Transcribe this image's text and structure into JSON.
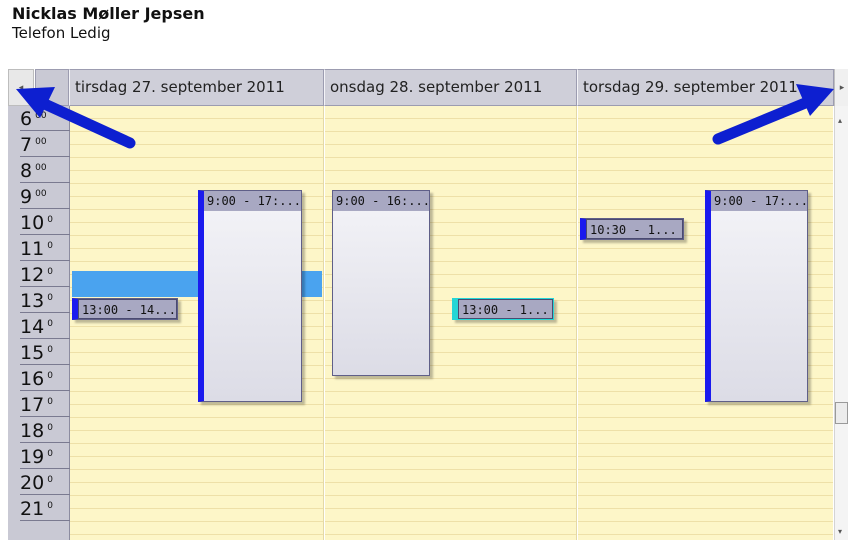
{
  "owner": {
    "name": "Nicklas Møller Jepsen",
    "subtitle": "Telefon Ledig"
  },
  "nav": {
    "prev_glyph": "◂",
    "next_glyph": "▸"
  },
  "days": [
    {
      "label": "tirsdag 27. september 2011"
    },
    {
      "label": "onsdag 28. september 2011"
    },
    {
      "label": "torsdag 29. september 2011"
    }
  ],
  "hours": [
    {
      "h": "6",
      "m": "00"
    },
    {
      "h": "7",
      "m": "00"
    },
    {
      "h": "8",
      "m": "00"
    },
    {
      "h": "9",
      "m": "00"
    },
    {
      "h": "10",
      "m": "0"
    },
    {
      "h": "11",
      "m": "0"
    },
    {
      "h": "12",
      "m": "0"
    },
    {
      "h": "13",
      "m": "0"
    },
    {
      "h": "14",
      "m": "0"
    },
    {
      "h": "15",
      "m": "0"
    },
    {
      "h": "16",
      "m": "0"
    },
    {
      "h": "17",
      "m": "0"
    },
    {
      "h": "18",
      "m": "0"
    },
    {
      "h": "19",
      "m": "0"
    },
    {
      "h": "20",
      "m": "0"
    },
    {
      "h": "21",
      "m": "0"
    }
  ],
  "appointments": [
    {
      "label": "9:00 - 17:..."
    },
    {
      "label": "13:00 - 14..."
    },
    {
      "label": "9:00 - 16:..."
    },
    {
      "label": "13:00 - 1..."
    },
    {
      "label": "10:30 - 1..."
    },
    {
      "label": "9:00 - 17:..."
    }
  ],
  "scrollbar": {
    "up_glyph": "▴",
    "down_glyph": "▾"
  },
  "colors": {
    "grid_bg": "#fdf6c8",
    "header_bg": "#cfcfd9",
    "appt_border": "#1a1aee",
    "selection": "#4aa3ef",
    "arrow": "#1a3fd6"
  }
}
